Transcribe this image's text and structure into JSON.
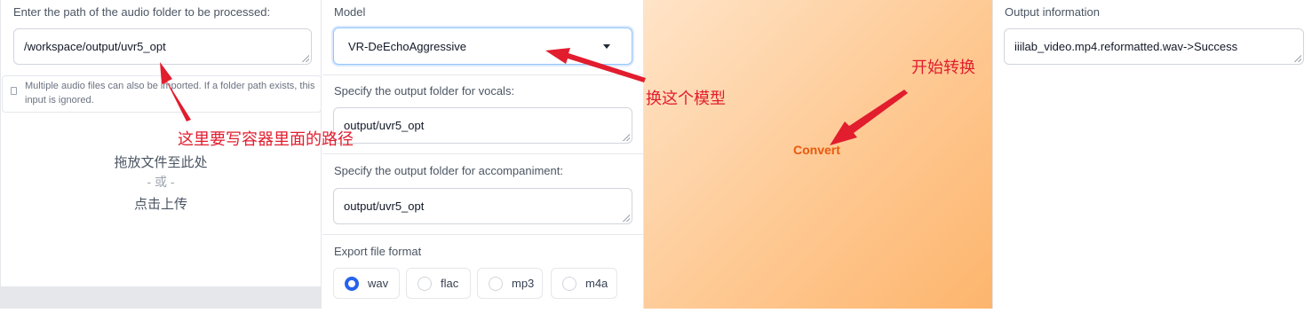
{
  "input_panel": {
    "label": "Enter the path of the audio folder to be processed:",
    "value": "/workspace/output/uvr5_opt",
    "info": "Multiple audio files can also be imported. If a folder path exists, this input is ignored.",
    "upload_line1": "拖放文件至此处",
    "upload_line2": "- 或 -",
    "upload_line3": "点击上传"
  },
  "settings_panel": {
    "model_label": "Model",
    "model_value": "VR-DeEchoAggressive",
    "vocals_label": "Specify the output folder for vocals:",
    "vocals_value": "output/uvr5_opt",
    "accompaniment_label": "Specify the output folder for accompaniment:",
    "accompaniment_value": "output/uvr5_opt",
    "format_label": "Export file format",
    "formats": [
      {
        "label": "wav",
        "selected": true
      },
      {
        "label": "flac",
        "selected": false
      },
      {
        "label": "mp3",
        "selected": false
      },
      {
        "label": "m4a",
        "selected": false
      }
    ]
  },
  "action_panel": {
    "convert_label": "Convert"
  },
  "output_panel": {
    "label": "Output information",
    "value": "iiilab_video.mp4.reformatted.wav->Success"
  },
  "annotations": {
    "path_note": "这里要写容器里面的路径",
    "model_note": "换这个模型",
    "convert_note": "开始转换",
    "color": "#e11d2e"
  },
  "colors": {
    "accent": "#2563eb",
    "convert_text": "#ea580c",
    "gradient_start": "#ffe4c8",
    "gradient_end": "#fdb56d"
  }
}
